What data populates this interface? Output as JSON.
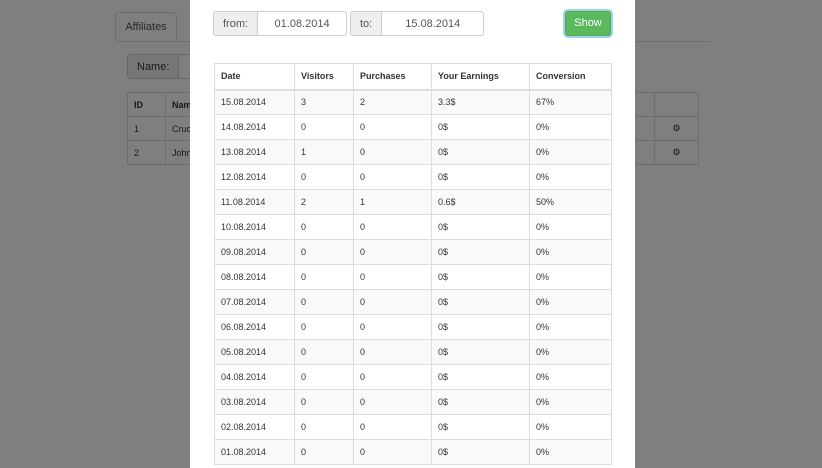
{
  "background": {
    "tabs": [
      {
        "label": "Affiliates"
      }
    ],
    "name_filter_label": "Name:",
    "table": {
      "headers": [
        "ID",
        "Nam"
      ],
      "rows": [
        {
          "id": "1",
          "name": "Cruc"
        },
        {
          "id": "2",
          "name": "John"
        }
      ]
    },
    "row_action_icon": "gear-icon"
  },
  "modal": {
    "from_label": "from:",
    "from_value": "01.08.2014",
    "to_label": "to:",
    "to_value": "15.08.2014",
    "show_label": "Show",
    "show_color": "#5cb85c",
    "table": {
      "headers": [
        "Date",
        "Visitors",
        "Purchases",
        "Your Earnings",
        "Conversion"
      ],
      "rows": [
        [
          "15.08.2014",
          "3",
          "2",
          "3.3$",
          "67%"
        ],
        [
          "14.08.2014",
          "0",
          "0",
          "0$",
          "0%"
        ],
        [
          "13.08.2014",
          "1",
          "0",
          "0$",
          "0%"
        ],
        [
          "12.08.2014",
          "0",
          "0",
          "0$",
          "0%"
        ],
        [
          "11.08.2014",
          "2",
          "1",
          "0.6$",
          "50%"
        ],
        [
          "10.08.2014",
          "0",
          "0",
          "0$",
          "0%"
        ],
        [
          "09.08.2014",
          "0",
          "0",
          "0$",
          "0%"
        ],
        [
          "08.08.2014",
          "0",
          "0",
          "0$",
          "0%"
        ],
        [
          "07.08.2014",
          "0",
          "0",
          "0$",
          "0%"
        ],
        [
          "06.08.2014",
          "0",
          "0",
          "0$",
          "0%"
        ],
        [
          "05.08.2014",
          "0",
          "0",
          "0$",
          "0%"
        ],
        [
          "04.08.2014",
          "0",
          "0",
          "0$",
          "0%"
        ],
        [
          "03.08.2014",
          "0",
          "0",
          "0$",
          "0%"
        ],
        [
          "02.08.2014",
          "0",
          "0",
          "0$",
          "0%"
        ],
        [
          "01.08.2014",
          "0",
          "0",
          "0$",
          "0%"
        ]
      ]
    }
  }
}
